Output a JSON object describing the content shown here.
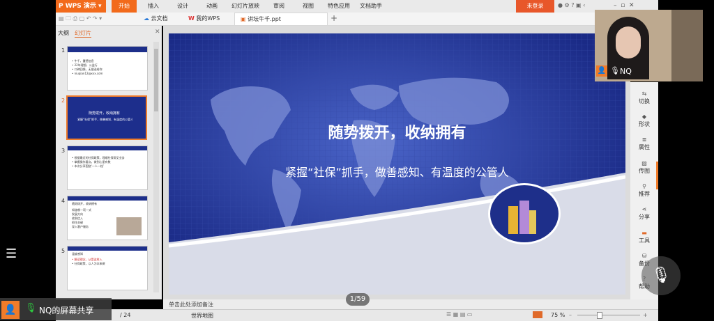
{
  "app": {
    "name": "WPS 演示",
    "login": "未登录"
  },
  "menu": [
    "开始",
    "插入",
    "设计",
    "动画",
    "幻灯片放映",
    "审阅",
    "视图",
    "特色应用",
    "文档助手"
  ],
  "tabs": [
    "云文档",
    "我的WPS",
    "讲坛牛千.ppt"
  ],
  "panel": {
    "tab_outline": "大纲",
    "tab_slides": "幻灯片"
  },
  "thumbs": [
    {
      "num": "1",
      "lines": [
        "• 牛千，肇德信息",
        "• 22年理想，公益行",
        "• 口碑回馈，无偿送给你",
        "• niuqian12@xxx.com"
      ]
    },
    {
      "num": "2",
      "lines": [
        "随势拨开，收纳拥有",
        "紧握“社保”抓手，做善感知、有温度的公管人"
      ]
    },
    {
      "num": "3",
      "lines": [
        "• 根据最近的社保政策，理顺社保常见业务",
        "• 掌握操作要点，做到心里有数",
        "• 本次分享围绕‘一人一档’"
      ]
    },
    {
      "num": "4",
      "lines": [
        "随势拨开，收纳拥有",
        "知道哪一项一式",
        "发展方向",
        "收到信入",
        "抓住关键",
        "深入客户服务"
      ]
    },
    {
      "num": "5",
      "lines": [
        "温度感知",
        "• 解读理念，从是这样入",
        "• 社保政策，以人为本来做"
      ]
    }
  ],
  "slide": {
    "title": "随势拨开，收纳拥有",
    "subtitle": "紧握“社保”抓手，做善感知、有温度的公管人"
  },
  "right_toolbar": [
    "切换",
    "形状",
    "属性",
    "传图",
    "推荐",
    "分享",
    "工具",
    "备份",
    "帮助"
  ],
  "notes_placeholder": "单击此处添加备注",
  "status": {
    "slide_counter": "/ 24",
    "theme": "世界地图",
    "zoom": "75 %"
  },
  "page_indicator": "1/59",
  "camera": {
    "name": "NQ"
  },
  "share": {
    "label": "NQ的屏幕共享"
  }
}
